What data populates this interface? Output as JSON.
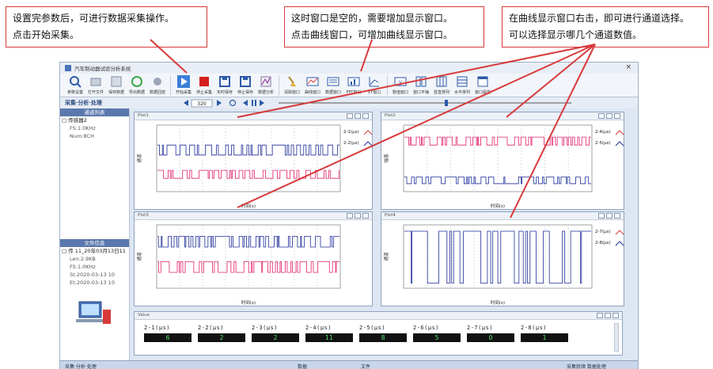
{
  "callouts": [
    {
      "line1": "设置完参数后，可进行数据采集操作。",
      "line2": "点击开始采集。"
    },
    {
      "line1": "这时窗口是空的，需要增加显示窗口。",
      "line2": "点击曲线窗口，可增加曲线显示窗口。"
    },
    {
      "line1": "在曲线显示窗口右击，即可进行通道选择。",
      "line2": "可以选择显示哪几个通道数值。"
    }
  ],
  "window": {
    "title": "汽车制动器试验分析系统"
  },
  "toolbar": [
    {
      "label": "参数设置",
      "icon": "magnifier-icon"
    },
    {
      "label": "打开文件",
      "icon": "folder-icon"
    },
    {
      "label": "保存数据",
      "icon": "save-data-icon"
    },
    {
      "label": "导出数据",
      "icon": "recycle-icon"
    },
    {
      "label": "数据回放",
      "icon": "gear-icon"
    },
    {
      "label": "开始采集",
      "icon": "play-icon"
    },
    {
      "label": "停止采集",
      "icon": "stop-icon"
    },
    {
      "label": "实时保存",
      "icon": "save-icon"
    },
    {
      "label": "停止保存",
      "icon": "save-icon"
    },
    {
      "label": "数据分析",
      "icon": "analysis-icon"
    },
    {
      "label": "清除窗口",
      "icon": "broom-icon"
    },
    {
      "label": "曲线窗口",
      "icon": "plot-icon"
    },
    {
      "label": "数据窗口",
      "icon": "mbs-icon"
    },
    {
      "label": "FFT窗口",
      "icon": "fft-icon"
    },
    {
      "label": "XY窗口",
      "icon": "xy-icon"
    },
    {
      "label": "数值窗口",
      "icon": "value-icon"
    },
    {
      "label": "窗口平铺",
      "icon": "tile-icon"
    },
    {
      "label": "竖直排列",
      "icon": "vertical-icon"
    },
    {
      "label": "水平排列",
      "icon": "horizontal-icon"
    },
    {
      "label": "窗口属性",
      "icon": "window-icon"
    }
  ],
  "nav": {
    "title": "采集·分析·处理",
    "step_value": "320"
  },
  "left": {
    "channel_head": "通道列表",
    "channel_tree": [
      "□ 传感器2",
      "FS:1.0KHz",
      "Num:8CH"
    ],
    "file_head": "文件信息",
    "file_tree": [
      "□ 传 11_20年03月13日11",
      "Len:2.9KB",
      "FS:1.0KHz",
      "St:2020-03-13 10",
      "Et:2020-03-13 10"
    ]
  },
  "plots": [
    {
      "title": "Plot1",
      "legend": [
        "2-1(μs)",
        "2-2(μs)"
      ],
      "ylabel": "通道",
      "xlabel": "时间(s)"
    },
    {
      "title": "Plot2",
      "legend": [
        "2-4(μs)",
        "2-5(μs)"
      ],
      "ylabel": "幅值",
      "xlabel": "时间(s)"
    },
    {
      "title": "Plot3",
      "legend": [],
      "ylabel": "通道",
      "xlabel": "时间(s)"
    },
    {
      "title": "Plot4",
      "legend": [
        "2-7(μs)",
        "2-8(μs)"
      ],
      "ylabel": "通道",
      "xlabel": "时间(s)"
    }
  ],
  "value_panel": {
    "title": "Value",
    "cells": [
      {
        "label": "2-1(μs)",
        "value": "6"
      },
      {
        "label": "2-2(μs)",
        "value": "2"
      },
      {
        "label": "2-3(μs)",
        "value": "2"
      },
      {
        "label": "2-4(μs)",
        "value": "11"
      },
      {
        "label": "2-5(μs)",
        "value": "8"
      },
      {
        "label": "2-6(μs)",
        "value": "5"
      },
      {
        "label": "2-7(μs)",
        "value": "0"
      },
      {
        "label": "2-8(μs)",
        "value": "1"
      }
    ]
  },
  "status": {
    "left": "采集·分析·处理",
    "mid1": "数据",
    "mid2": "文件",
    "right": "采集就绪 数据处理"
  },
  "colors": {
    "accent_red": "#d83a3a",
    "series_blue": "#1f2f9a",
    "series_pink": "#e0206a",
    "panel_blue": "#5a78ad"
  }
}
